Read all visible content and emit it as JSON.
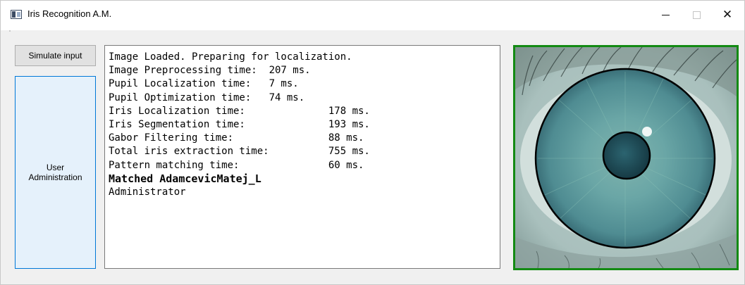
{
  "window": {
    "title": "Iris Recognition A.M.",
    "controls": {
      "minimize": "—",
      "maximize": "☐",
      "close": "✕"
    }
  },
  "sidebar": {
    "simulate_label": "Simulate input",
    "user_admin_label": "User Administration"
  },
  "log": {
    "lines": [
      {
        "text": "Image Loaded. Preparing for localization.",
        "bold": false
      },
      {
        "text": "Image Preprocessing time:  207 ms.",
        "bold": false
      },
      {
        "text": "Pupil Localization time:   7 ms.",
        "bold": false
      },
      {
        "text": "Pupil Optimization time:   74 ms.",
        "bold": false
      },
      {
        "text": "Iris Localization time:              178 ms.",
        "bold": false
      },
      {
        "text": "Iris Segmentation time:              193 ms.",
        "bold": false
      },
      {
        "text": "Gabor Filtering time:                88 ms.",
        "bold": false
      },
      {
        "text": "Total iris extraction time:          755 ms.",
        "bold": false
      },
      {
        "text": "Pattern matching time:               60 ms.",
        "bold": false
      },
      {
        "text": "Matched AdamcevicMatej_L",
        "bold": true
      },
      {
        "text": "Administrator",
        "bold": false
      }
    ]
  },
  "eye_image": {
    "frame_color": "#138a13",
    "iris_color": "#5e9aa0",
    "pupil_color": "#1f4d58"
  }
}
